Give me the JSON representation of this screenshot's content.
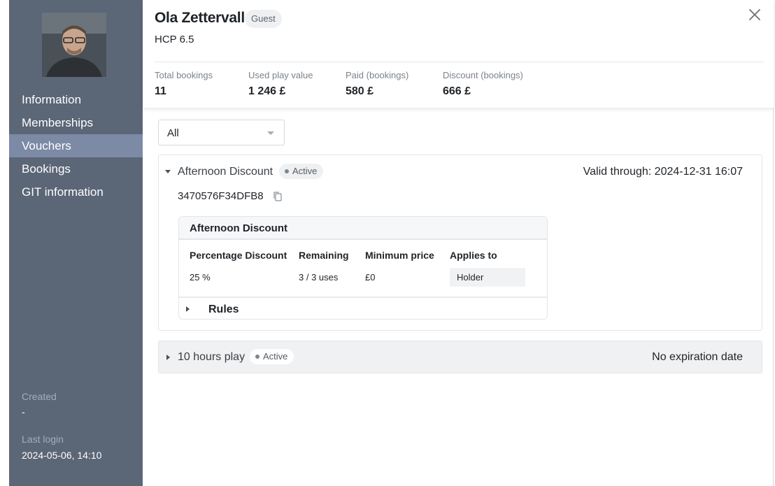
{
  "profile": {
    "name": "Ola Zettervall",
    "badge": "Guest",
    "hcp": "HCP 6.5"
  },
  "sidebar": {
    "items": [
      {
        "label": "Information"
      },
      {
        "label": "Memberships"
      },
      {
        "label": "Vouchers"
      },
      {
        "label": "Bookings"
      },
      {
        "label": "GIT information"
      }
    ],
    "active_index": 2,
    "created_label": "Created",
    "created_value": "-",
    "last_login_label": "Last login",
    "last_login_value": "2024-05-06, 14:10"
  },
  "stats": [
    {
      "label": "Total bookings",
      "value": "11"
    },
    {
      "label": "Used play value",
      "value": "1 246 £"
    },
    {
      "label": "Paid (bookings)",
      "value": "580 £"
    },
    {
      "label": "Discount (bookings)",
      "value": "666 £"
    }
  ],
  "filter": {
    "value": "All"
  },
  "vouchers": [
    {
      "title": "Afternoon Discount",
      "status": "Active",
      "expanded": true,
      "validity": "Valid through: 2024-12-31 16:07",
      "code": "3470576F34DFB8",
      "card": {
        "title": "Afternoon Discount",
        "headers": [
          "Percentage Discount",
          "Remaining",
          "Minimum price",
          "Applies to"
        ],
        "values": [
          "25 %",
          "3 / 3 uses",
          "£0",
          "Holder"
        ],
        "rules_label": "Rules"
      }
    },
    {
      "title": "10 hours play",
      "status": "Active",
      "expanded": false,
      "validity": "No expiration date"
    }
  ],
  "icons": {
    "close": "close-icon",
    "copy": "copy-icon",
    "dropdown": "chevron-down-icon"
  },
  "colors": {
    "sidebar_bg": "#5b6677",
    "sidebar_active": "#7c8aa6",
    "badge_bg": "#eef0f2"
  }
}
